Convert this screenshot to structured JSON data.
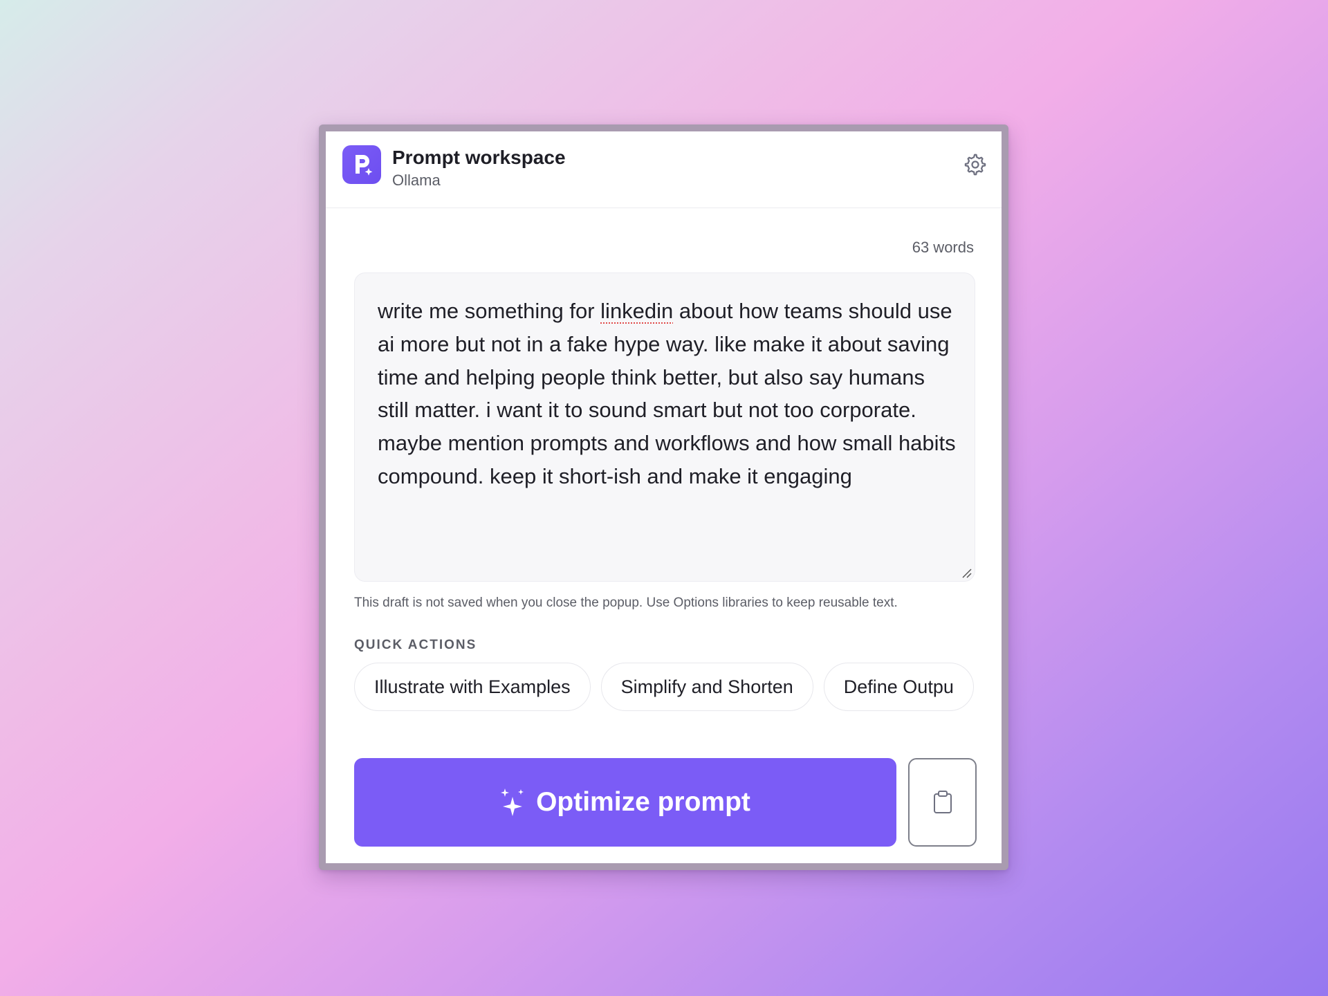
{
  "header": {
    "title": "Prompt workspace",
    "subtitle": "Ollama",
    "logo_icon": "p-sparkle-logo-icon",
    "settings_icon": "gear-icon"
  },
  "editor": {
    "word_count": "63 words",
    "text_before": "write me something for ",
    "text_flagged": "linkedin",
    "text_after": " about how teams should use ai more but not in a fake hype way. like make it about saving time and helping people think better, but also say humans still matter. i want it to sound smart but not too corporate. maybe mention prompts and workflows and how small habits compound. keep it short-ish and make it engaging",
    "note": "This draft is not saved when you close the popup. Use Options libraries to keep reusable text."
  },
  "quick_actions": {
    "title": "QUICK ACTIONS",
    "items": [
      {
        "label": "Illustrate with Examples"
      },
      {
        "label": "Simplify and Shorten"
      },
      {
        "label": "Define Outpu"
      }
    ]
  },
  "actions": {
    "optimize_label": "Optimize prompt",
    "optimize_icon": "sparkle-icon",
    "copy_icon": "clipboard-icon"
  },
  "colors": {
    "accent": "#7b5cf6",
    "text": "#1f1f27",
    "muted": "#5b5d66"
  }
}
